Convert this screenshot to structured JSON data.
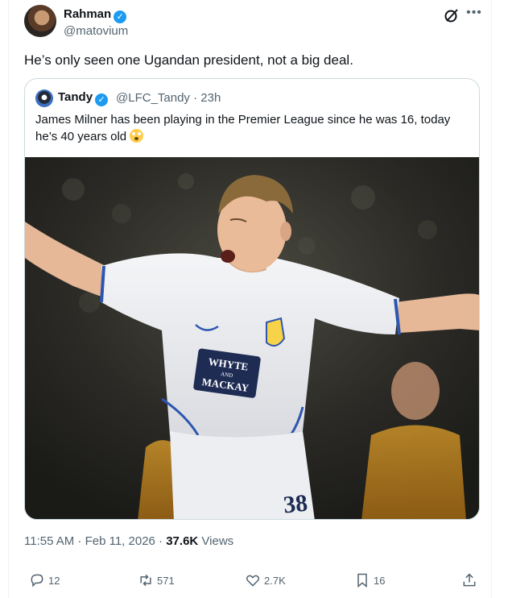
{
  "tweet": {
    "author_name": "Rahman",
    "author_handle": "@matovium",
    "text": "He’s only seen one Ugandan president, not a big deal.",
    "time": "11:55 AM · Feb 11, 2026 · ",
    "views_count": "37.6K",
    "views_label": " Views"
  },
  "quote": {
    "author_name": "Tandy",
    "author_handle": "@LFC_Tandy · 23h",
    "text_line1": "James Milner has been playing in the Premier League since he was 16, today",
    "text_line2": "he’s 40 years old",
    "photo": {
      "description_icons": "football-player-photo",
      "shirt_sponsor_line1": "WHYTE",
      "shirt_sponsor_line2": "AND",
      "shirt_sponsor_line3": "MACKAY",
      "shirt_number": "38"
    }
  },
  "actions": {
    "replies": "12",
    "reposts": "571",
    "likes": "2.7K",
    "bookmarks": "16"
  },
  "colors": {
    "accent": "#1d9bf0",
    "text_primary": "#0f1419",
    "text_secondary": "#536471",
    "border": "#cfd9de"
  }
}
